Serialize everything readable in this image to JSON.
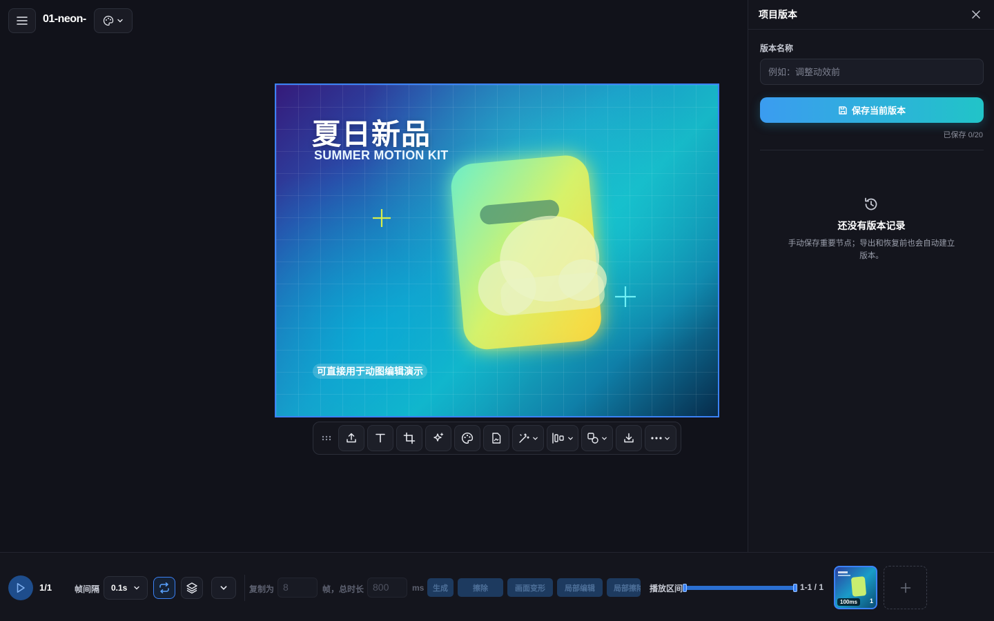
{
  "header": {
    "project_name": "01-neon-"
  },
  "canvas": {
    "title": "夏日新品",
    "subtitle": "SUMMER MOTION KIT",
    "caption": "可直接用于动图编辑演示"
  },
  "panel": {
    "title": "项目版本",
    "version_name_label": "版本名称",
    "version_name_placeholder": "例如：调整动效前",
    "version_name_value": "",
    "save_label": "保存当前版本",
    "saved_count": "已保存 0/20",
    "empty_title": "还没有版本记录",
    "empty_desc": "手动保存重要节点；导出和恢复前也会自动建立版本。"
  },
  "bottombar": {
    "frame_count": "1/1",
    "interval_label": "帧间隔",
    "interval_value": "0.1s",
    "copy_label": "复制为",
    "copy_value": "8",
    "frames_total_label": "帧，总时长",
    "total_value": "800",
    "ms_label": "ms",
    "actions": [
      "生成",
      "擦除",
      "画面变形",
      "局部编辑",
      "局部擦除"
    ],
    "range_label": "播放区间",
    "range_value": "1-1 / 1",
    "thumb_duration": "100ms",
    "thumb_index": "1"
  },
  "colors": {
    "accent": "#3b82f6",
    "save_gradient_start": "#3b9cf0",
    "save_gradient_end": "#21c4c8",
    "background": "#11121a",
    "panel": "#14151d"
  },
  "icons": {
    "menu": "menu-icon",
    "theme": "palette-icon",
    "toolbar": [
      "drag-handle-icon",
      "upload-icon",
      "text-icon",
      "crop-icon",
      "sparkle-icon",
      "palette-icon",
      "file-image-icon",
      "magic-wand-icon",
      "align-icon",
      "shapes-icon",
      "download-icon",
      "more-icon"
    ],
    "panel": [
      "close-icon",
      "save-icon",
      "history-icon"
    ],
    "bottombar": [
      "play-icon",
      "loop-icon",
      "layers-icon",
      "chevron-down-icon",
      "plus-icon"
    ]
  }
}
